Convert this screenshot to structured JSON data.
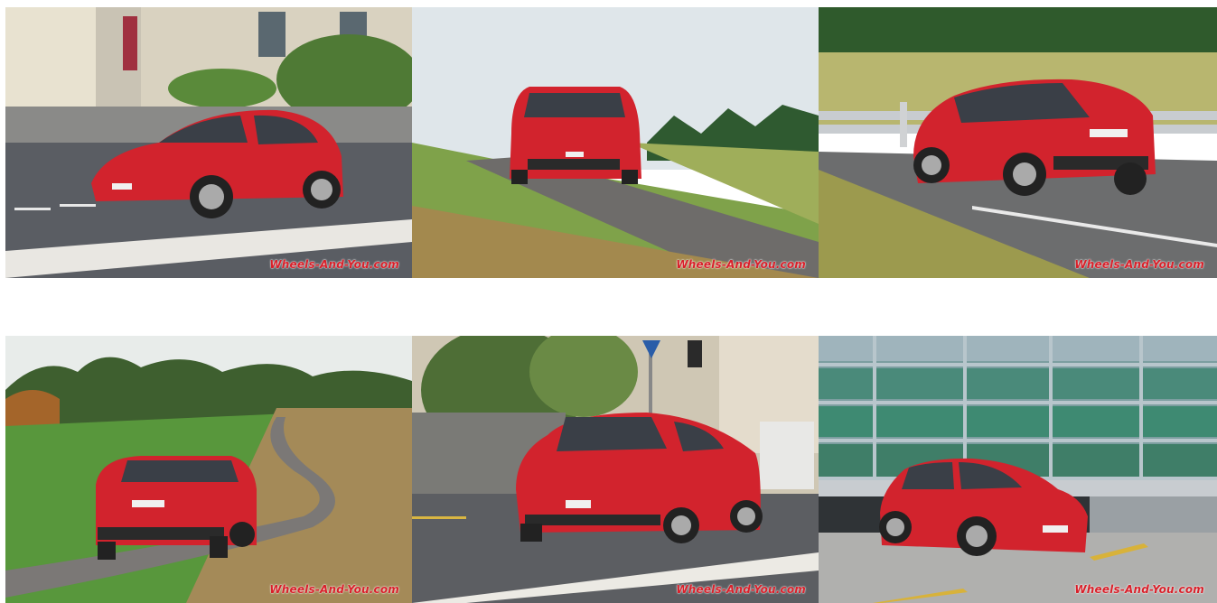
{
  "gallery": {
    "watermark": "Wheels-And-You.com",
    "car_color": "#d2232d",
    "photos": [
      {
        "subject": "car-front-three-quarter-street"
      },
      {
        "subject": "car-front-rural-road"
      },
      {
        "subject": "car-rear-three-quarter-motion"
      },
      {
        "subject": "car-rear-country-lane"
      },
      {
        "subject": "car-front-three-quarter-town"
      },
      {
        "subject": "car-side-front-glass-building"
      }
    ]
  }
}
